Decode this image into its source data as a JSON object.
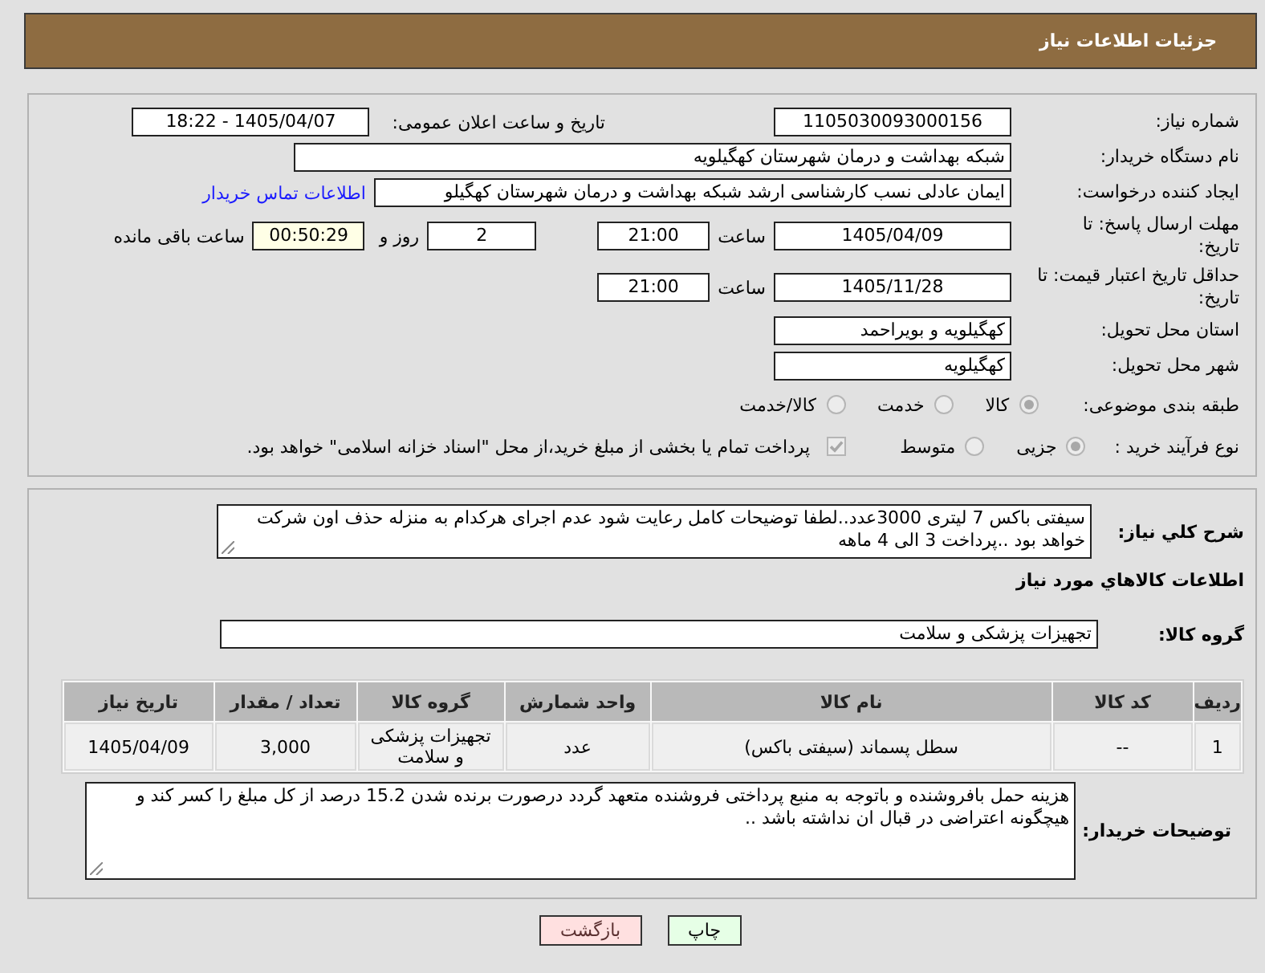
{
  "header": {
    "title": "جزئیات اطلاعات نیاز"
  },
  "details": {
    "need_number": {
      "label": "شماره نیاز:",
      "value": "1105030093000156"
    },
    "announce_datetime": {
      "label": "تاریخ و ساعت اعلان عمومی:",
      "value": "1405/04/07 - 18:22"
    },
    "buyer_org": {
      "label": "نام دستگاه خریدار:",
      "value": "شبکه بهداشت و درمان شهرستان کهگیلویه"
    },
    "requester": {
      "label": "ایجاد کننده درخواست:",
      "value": "ایمان عادلی نسب کارشناسی ارشد شبکه بهداشت و درمان شهرستان کهگیلو",
      "link": "اطلاعات تماس خریدار"
    },
    "response_deadline": {
      "label": "مهلت ارسال پاسخ: تا تاریخ:",
      "date": "1405/04/09",
      "time_label": "ساعت",
      "time": "21:00",
      "days": "2",
      "days_label": "روز و",
      "remaining": "00:50:29",
      "remaining_label": "ساعت باقی مانده"
    },
    "price_validity": {
      "label": "حداقل تاریخ اعتبار قیمت: تا تاریخ:",
      "date": "1405/11/28",
      "time_label": "ساعت",
      "time": "21:00"
    },
    "delivery_province": {
      "label": "استان محل تحویل:",
      "value": "کهگیلویه و بویراحمد"
    },
    "delivery_city": {
      "label": "شهر محل تحویل:",
      "value": "کهگیلویه"
    },
    "subject_category": {
      "label": "طبقه بندی موضوعی:",
      "disabled": true,
      "options": [
        {
          "label": "کالا",
          "selected": true
        },
        {
          "label": "خدمت",
          "selected": false
        },
        {
          "label": "کالا/خدمت",
          "selected": false
        }
      ]
    },
    "purchase_process": {
      "label": "نوع فرآیند خرید :",
      "disabled": true,
      "options": [
        {
          "label": "جزیی",
          "selected": true
        },
        {
          "label": "متوسط",
          "selected": false
        }
      ],
      "treasury_payment": {
        "label": "پرداخت تمام یا بخشی از مبلغ خرید،از محل \"اسناد خزانه اسلامی\" خواهد بود.",
        "checked": true,
        "disabled": true
      }
    }
  },
  "description": {
    "label": "شرح کلي نیاز:",
    "value": "سیفتی باکس 7 لیتری 3000عدد..لطفا توضیحات کامل رعایت شود عدم اجرای هرکدام به منزله حذف اون شرکت خواهد بود ..پرداخت 3 الی 4 ماهه"
  },
  "items": {
    "title": "اطلاعات کالاهاي مورد نیاز",
    "group": {
      "label": "گروه کالا:",
      "value": "تجهیزات پزشکی و سلامت"
    },
    "table": {
      "columns": [
        "ردیف",
        "کد کالا",
        "نام کالا",
        "واحد شمارش",
        "گروه کالا",
        "تعداد / مقدار",
        "تاریخ نیاز"
      ],
      "rows": [
        [
          "1",
          "--",
          "سطل پسماند (سیفتی باکس)",
          "عدد",
          "تجهیزات پزشکی و سلامت",
          "3,000",
          "1405/04/09"
        ]
      ]
    }
  },
  "buyer_notes": {
    "label": "توضیحات خریدار:",
    "value": "هزینه حمل بافروشنده و باتوجه به منبع پرداختی فروشنده متعهد گردد درصورت برنده شدن 15.2 درصد از کل مبلغ را کسر کند و هیچگونه اعتراضی در قبال ان نداشته باشد .."
  },
  "buttons": [
    {
      "label": "چاپ",
      "kind": "print"
    },
    {
      "label": "بازگشت",
      "kind": "back"
    }
  ]
}
